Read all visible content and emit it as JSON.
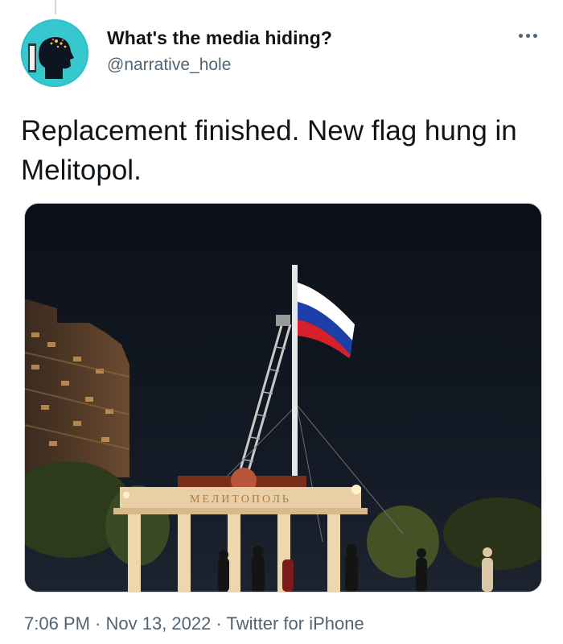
{
  "author": {
    "display_name": "What's the media hiding?",
    "handle": "@narrative_hole",
    "avatar_icon": "head-silhouette-icon"
  },
  "more_icon": "more-horizontal-icon",
  "tweet": {
    "text": "Replacement finished. New flag hung in Melitopol."
  },
  "media": {
    "sign_text": "МЕЛИТОПОЛЬ",
    "flag_colors": [
      "#ffffff",
      "#1c3fa8",
      "#d6202a"
    ]
  },
  "meta": {
    "time": "7:06 PM",
    "sep1": " · ",
    "date": "Nov 13, 2022",
    "sep2": " · ",
    "source": "Twitter for iPhone"
  },
  "colors": {
    "text_primary": "#0f1419",
    "text_secondary": "#536471",
    "avatar_bg": "#2cc1c9"
  }
}
